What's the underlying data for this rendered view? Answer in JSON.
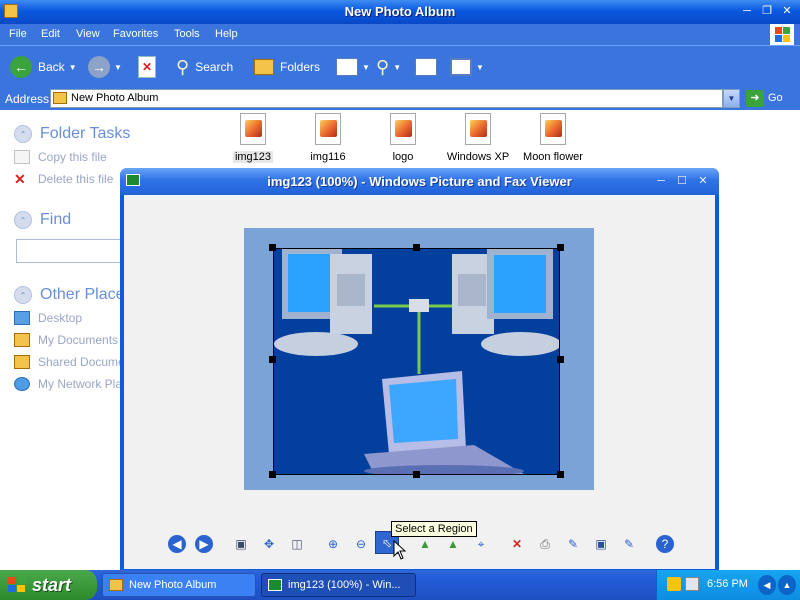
{
  "explorer": {
    "title": "New Photo Album",
    "menu": [
      "File",
      "Edit",
      "View",
      "Favorites",
      "Tools",
      "Help"
    ],
    "toolbar": {
      "back": "Back",
      "search": "Search",
      "folders": "Folders"
    },
    "address": {
      "label": "Address",
      "value": "New Photo Album",
      "go": "Go"
    },
    "left_pane": {
      "folder_tasks": {
        "title": "Folder Tasks",
        "items": [
          "Copy this file",
          "Delete this file"
        ]
      },
      "find": {
        "title": "Find",
        "input_value": ""
      },
      "other_places": {
        "title": "Other Places",
        "items": [
          "Desktop",
          "My Documents",
          "Shared Documents",
          "My Network Places"
        ]
      }
    },
    "files": [
      "img123",
      "img116",
      "logo",
      "Windows XP",
      "Moon flower"
    ],
    "selected_file": "img123"
  },
  "viewer": {
    "title": "img123 (100%) - Windows Picture and Fax Viewer",
    "tooltip": "Select a Region"
  },
  "taskbar": {
    "start": "start",
    "items": [
      "New Photo Album",
      "img123 (100%) - Win..."
    ],
    "active_item": 1,
    "clock": "6:56 PM"
  },
  "colors": {
    "xp_blue": "#0a59df",
    "toolbar_blue": "#3a75de",
    "task_link": "#9aa6c6",
    "pane_header": "#6a8fd6",
    "start_green": "#3a9a3a",
    "image_backdrop": "#7ba3d6",
    "image_bg": "#033f9d"
  }
}
